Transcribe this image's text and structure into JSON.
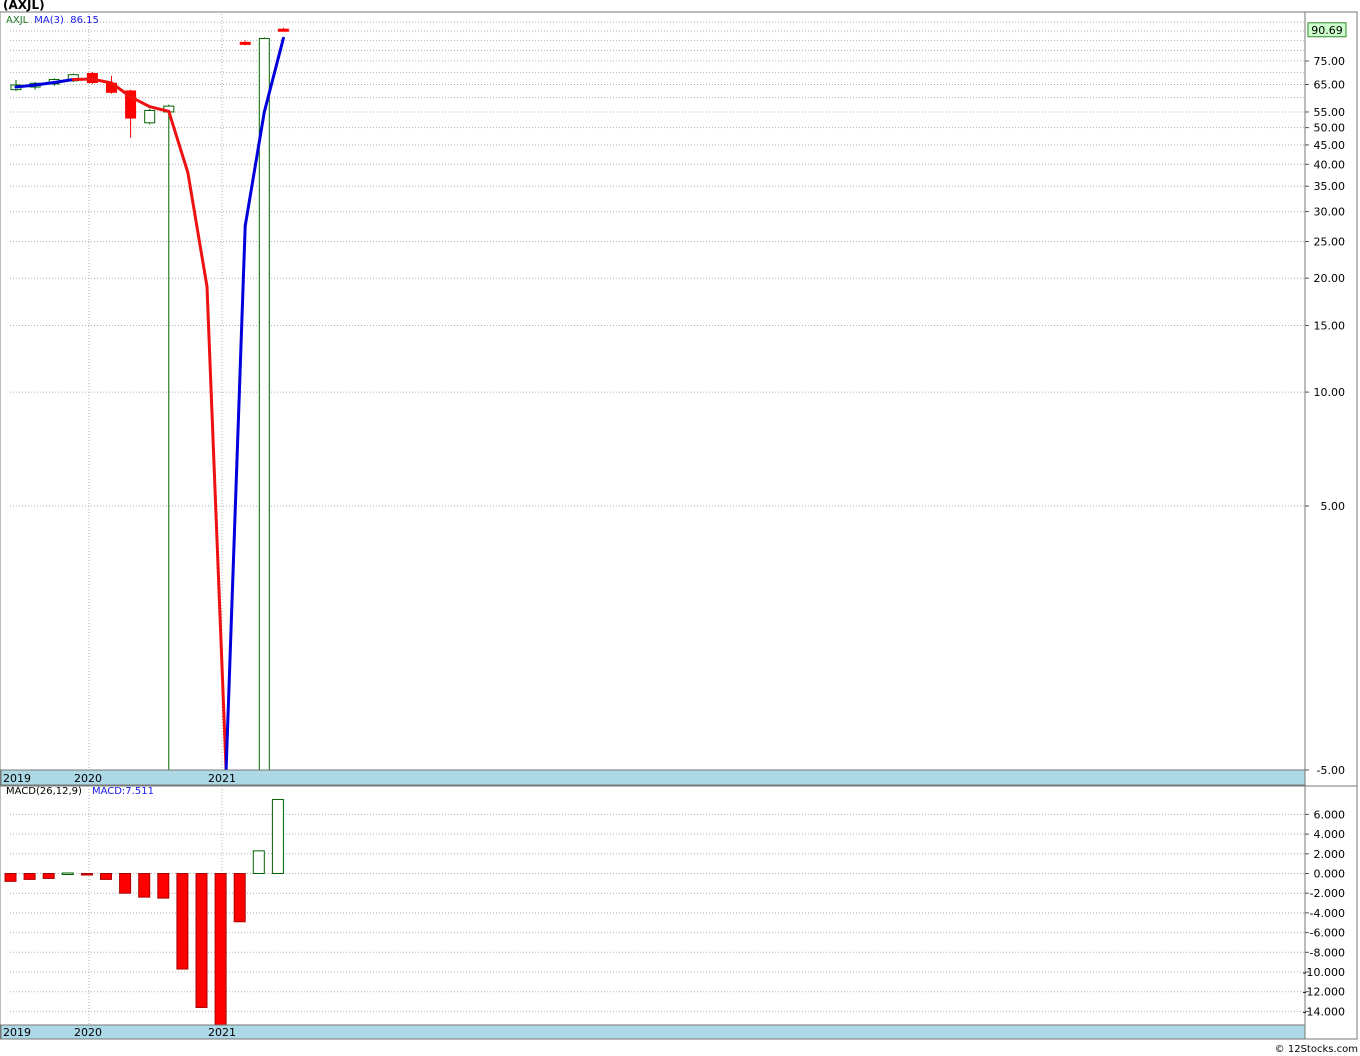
{
  "header": {
    "title": "(AXJL)"
  },
  "legend": {
    "symbol": "AXJL",
    "ma_label": "MA(3)",
    "ma_value": "86.15"
  },
  "macd_legend": {
    "label": "MACD(26,12,9)",
    "value": "MACD:7.511"
  },
  "footer": {
    "copyright": "© 12Stocks.com"
  },
  "colors": {
    "up": "#006400",
    "down": "#ff0000",
    "ma_up": "#0000dd",
    "ma_down": "#ee1111",
    "axis_band": "#add8e6",
    "grid": "#b0b0b0",
    "last_price_bg": "#ccffcc"
  },
  "chart_data": [
    {
      "type": "candlestick",
      "scale": "log",
      "interval": "quarterly",
      "x_tick_labels": [
        "2019",
        "2020",
        "2021"
      ],
      "y_tick_labels": [
        "90.69",
        "75.00",
        "65.00",
        "55.00",
        "50.00",
        "45.00",
        "40.00",
        "35.00",
        "30.00",
        "25.00",
        "20.00",
        "15.00",
        "10.00",
        "5.00",
        "-5.00"
      ],
      "y_ticks": [
        75,
        65,
        55,
        50,
        45,
        40,
        35,
        30,
        25,
        20,
        15,
        10,
        5
      ],
      "last_price": "90.69",
      "candles": [
        {
          "o": 63.0,
          "h": 66.8,
          "l": 62.5,
          "c": 64.8
        },
        {
          "o": 64.0,
          "h": 66.0,
          "l": 63.0,
          "c": 65.5
        },
        {
          "o": 65.2,
          "h": 67.5,
          "l": 64.5,
          "c": 67.0
        },
        {
          "o": 66.5,
          "h": 69.5,
          "l": 66.0,
          "c": 69.0
        },
        {
          "o": 69.5,
          "h": 70.2,
          "l": 65.2,
          "c": 65.8
        },
        {
          "o": 65.5,
          "h": 68.5,
          "l": 61.5,
          "c": 62.0
        },
        {
          "o": 62.5,
          "h": 63.0,
          "l": 47.0,
          "c": 53.0
        },
        {
          "o": 51.5,
          "h": 56.0,
          "l": 51.0,
          "c": 55.5
        },
        {
          "o": 55.0,
          "h": 57.5,
          "l": 0.01,
          "c": 57.0
        },
        {
          "o": 84.0,
          "h": 85.0,
          "l": 82.5,
          "c": 83.0
        },
        {
          "o": 0.01,
          "h": 86.5,
          "l": 0.01,
          "c": 86.0
        },
        {
          "o": 91.0,
          "h": 91.8,
          "l": 90.3,
          "c": 90.6
        }
      ],
      "ma": {
        "name": "MA(3)",
        "points": [
          {
            "i": 0,
            "v": 64.0,
            "trend": "down"
          },
          {
            "i": 1,
            "v": 64.8,
            "trend": "up"
          },
          {
            "i": 2,
            "v": 65.8,
            "trend": "up"
          },
          {
            "i": 3,
            "v": 67.0,
            "trend": "up"
          },
          {
            "i": 4,
            "v": 67.2,
            "trend": "down"
          },
          {
            "i": 5,
            "v": 65.6,
            "trend": "down"
          },
          {
            "i": 6,
            "v": 60.3,
            "trend": "down"
          },
          {
            "i": 7,
            "v": 56.8,
            "trend": "down"
          },
          {
            "i": 8,
            "v": 55.2,
            "trend": "down"
          },
          {
            "i": 9,
            "v": 38.0,
            "trend": "down"
          },
          {
            "i": 10,
            "v": 19.0,
            "trend": "down"
          },
          {
            "i": 11,
            "v": 0.01,
            "trend": "down"
          },
          {
            "i": 12,
            "v": 27.5,
            "trend": "up"
          },
          {
            "i": 13,
            "v": 55.0,
            "trend": "up"
          },
          {
            "i": 14,
            "v": 86.15,
            "trend": "up"
          }
        ]
      }
    },
    {
      "type": "bar",
      "title": "MACD(26,12,9)",
      "x_tick_labels": [
        "2019",
        "2020",
        "2021"
      ],
      "y_tick_labels": [
        "6.000",
        "4.000",
        "2.000",
        "0.000",
        "-2.000",
        "-4.000",
        "-6.000",
        "-8.000",
        "-10.000",
        "-12.000",
        "-14.000"
      ],
      "y_ticks": [
        6,
        4,
        2,
        0,
        -2,
        -4,
        -6,
        -8,
        -10,
        -12,
        -14
      ],
      "ylim": [
        -15.5,
        7.5
      ],
      "values": [
        -0.8,
        -0.6,
        -0.5,
        0.05,
        -0.15,
        -0.6,
        -2.0,
        -2.4,
        -2.5,
        -9.7,
        -13.6,
        -15.5,
        -4.9,
        2.3,
        7.511
      ]
    }
  ]
}
